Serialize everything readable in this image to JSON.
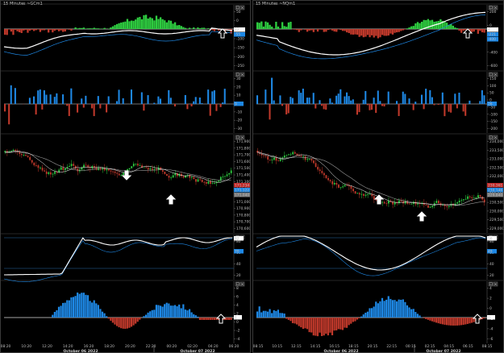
{
  "windows": [
    {
      "title": "15 Minutes ~GCm1",
      "controls": [
        "☐",
        "×"
      ],
      "panels": [
        {
          "type": "osc",
          "ticks": [
            "50",
            "0",
            "-50",
            "-100",
            "-150",
            "-200",
            "-250"
          ],
          "value_labels": [
            {
              "text": "12",
              "color": "#ffffff",
              "text_color": "#000000"
            },
            {
              "text": "-55",
              "color": "#1e88e5",
              "text_color": "#ffffff"
            }
          ],
          "arrow": "up"
        },
        {
          "type": "bars",
          "ticks": [
            "30",
            "20",
            "10",
            "0",
            "-10",
            "-20",
            "-30"
          ],
          "value_labels": [
            {
              "text": "9",
              "color": "#1e88e5",
              "text_color": "#ffffff"
            }
          ]
        },
        {
          "type": "price",
          "ticks": [
            "171,900",
            "171,800",
            "171,700",
            "171,600",
            "171,500",
            "171,400",
            "171,300",
            "171,200",
            "171,100",
            "171,000",
            "170,900",
            "170,800",
            "170,700",
            "170,600"
          ],
          "value_labels": [
            {
              "text": "171,234",
              "color": "#c62828",
              "text_color": "#ffffff"
            },
            {
              "text": "171,122",
              "color": "#1e88e5",
              "text_color": "#ffffff"
            },
            {
              "text": "171,040",
              "color": "#777777",
              "text_color": "#ffffff"
            }
          ],
          "arrows": [
            "down",
            "up"
          ]
        },
        {
          "type": "stoch",
          "ticks": [
            "80",
            "60",
            "40",
            "20"
          ],
          "value_labels": [
            {
              "text": "82",
              "color": "#ffffff",
              "text_color": "#000000"
            },
            {
              "text": "70",
              "color": "#1e88e5",
              "text_color": "#ffffff"
            }
          ]
        },
        {
          "type": "hist",
          "ticks": [
            "8",
            "6",
            "4",
            "2",
            "0",
            "-2",
            "-4"
          ],
          "value_labels": [
            {
              "text": "1",
              "color": "#ffffff",
              "text_color": "#000000"
            }
          ],
          "arrow": "up"
        }
      ],
      "x_ticks": [
        "08:20",
        "10:20",
        "12:20",
        "14:20",
        "16:20",
        "18:20",
        "20:20",
        "22:20",
        "00:20",
        "02:20",
        "04:20",
        "06:20"
      ],
      "date_labels": [
        "October 06 2022",
        "October 07 2022"
      ]
    },
    {
      "title": "15 Minutes ~NQm1",
      "controls": [
        "☐",
        "×"
      ],
      "panels": [
        {
          "type": "osc",
          "ticks": [
            "200",
            "0",
            "-200",
            "-400",
            "-600"
          ],
          "value_labels": [
            {
              "text": "4",
              "color": "#ffffff",
              "text_color": "#000000"
            },
            {
              "text": "-221",
              "color": "#1e88e5",
              "text_color": "#ffffff"
            },
            {
              "text": "-400",
              "color": "#1e88e5",
              "text_color": "#ffffff"
            }
          ],
          "arrow": "up"
        },
        {
          "type": "bars",
          "ticks": [
            "150",
            "100",
            "50",
            "0",
            "-50",
            "-100",
            "-150",
            "-200"
          ],
          "value_labels": [
            {
              "text": "26",
              "color": "#1e88e5",
              "text_color": "#ffffff"
            }
          ]
        },
        {
          "type": "price",
          "ticks": [
            "234,000",
            "233,500",
            "233,000",
            "232,500",
            "232,000",
            "231,500",
            "231,000",
            "230,500",
            "230,000",
            "229,500",
            "229,000"
          ],
          "value_labels": [
            {
              "text": "230,361",
              "color": "#c62828",
              "text_color": "#ffffff"
            },
            {
              "text": "230,146",
              "color": "#1e88e5",
              "text_color": "#ffffff"
            },
            {
              "text": "229,840",
              "color": "#777777",
              "text_color": "#ffffff"
            }
          ],
          "arrows": [
            "up",
            "up"
          ]
        },
        {
          "type": "stoch",
          "ticks": [
            "80",
            "60",
            "40",
            "20"
          ],
          "value_labels": [
            {
              "text": "56",
              "color": "#ffffff",
              "text_color": "#000000"
            },
            {
              "text": "49",
              "color": "#1e88e5",
              "text_color": "#ffffff"
            }
          ]
        },
        {
          "type": "hist",
          "ticks": [
            "4",
            "2",
            "0",
            "-2",
            "-4",
            "-6"
          ],
          "value_labels": [
            {
              "text": "0",
              "color": "#ffffff",
              "text_color": "#000000"
            }
          ],
          "arrow": "up"
        }
      ],
      "x_ticks": [
        "08:15",
        "10:15",
        "12:15",
        "14:15",
        "16:15",
        "18:15",
        "20:15",
        "22:15",
        "00:15",
        "02:15",
        "04:15",
        "06:15",
        "08:15"
      ],
      "date_labels": [
        "October 06 2022",
        "October 07 2022"
      ]
    }
  ],
  "colors": {
    "up": "#2ecc40",
    "down": "#c0392b",
    "blue": "#1e88e5",
    "white": "#ffffff",
    "grid": "#2a3a5a"
  }
}
